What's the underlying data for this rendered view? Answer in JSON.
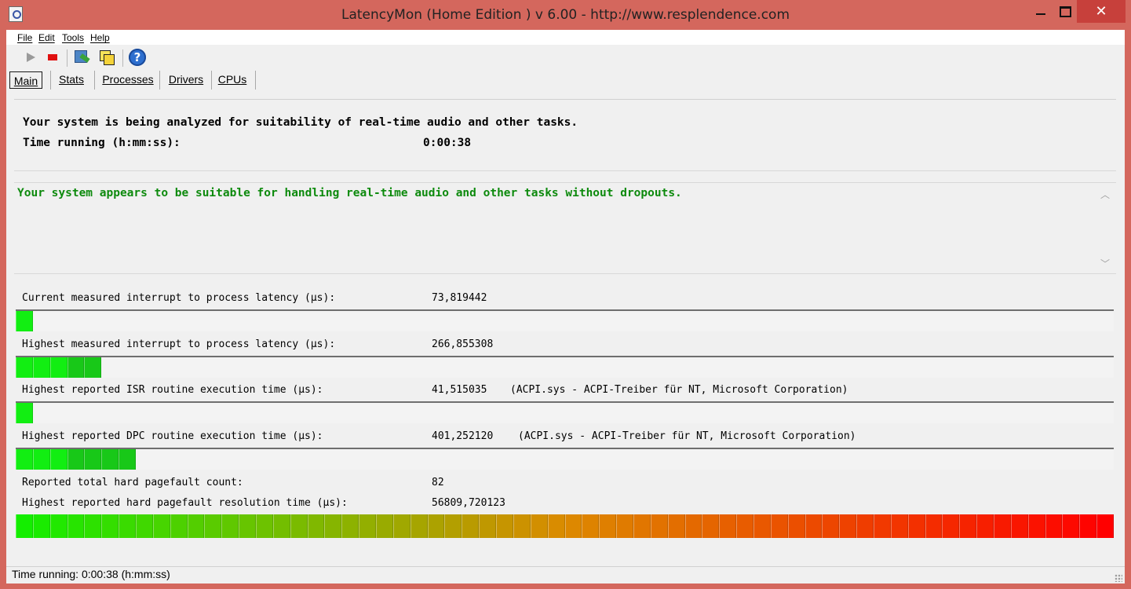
{
  "window": {
    "title": "LatencyMon  (Home Edition )  v 6.00 - http://www.resplendence.com",
    "close_glyph": "✕"
  },
  "menu": [
    "File",
    "Edit",
    "Tools",
    "Help"
  ],
  "toolbar": {
    "buttons": [
      "play-icon",
      "stop-icon",
      "tool-icon",
      "windows-icon",
      "help-icon"
    ]
  },
  "tabs": [
    "Main",
    "Stats",
    "Processes",
    "Drivers",
    "CPUs"
  ],
  "header": {
    "line1": "Your system is being analyzed for suitability of real-time audio and other tasks.",
    "line2_label": "Time running (h:mm:ss):",
    "line2_value": "0:00:38"
  },
  "conclusion": {
    "text": "Your system appears to be suitable for handling real-time audio and other tasks without dropouts.",
    "color": "#0d8a0d"
  },
  "metrics": [
    {
      "label": "Current measured interrupt to process latency (µs):",
      "value": "73,819442",
      "extra": "",
      "bar_segments": 1
    },
    {
      "label": "Highest measured interrupt to process latency (µs):",
      "value": "266,855308",
      "extra": "",
      "bar_segments": 5
    },
    {
      "label": "Highest reported ISR routine execution time (µs):",
      "value": "41,515035",
      "extra": "(ACPI.sys - ACPI-Treiber für NT, Microsoft Corporation)",
      "bar_segments": 1
    },
    {
      "label": "Highest reported DPC routine execution time (µs):",
      "value": "401,252120",
      "extra": "(ACPI.sys - ACPI-Treiber für NT, Microsoft Corporation)",
      "bar_segments": 7
    }
  ],
  "pagefault": {
    "count_label": "Reported total hard pagefault count:",
    "count_value": "82",
    "time_label": "Highest reported hard pagefault resolution time (µs):",
    "time_value": "56809,720123",
    "bar_segments": 64
  },
  "bar_max_segments": 64,
  "colors": {
    "green": "#12ee12",
    "red": "#ff0000"
  },
  "statusbar": "Time running: 0:00:38  (h:mm:ss)"
}
